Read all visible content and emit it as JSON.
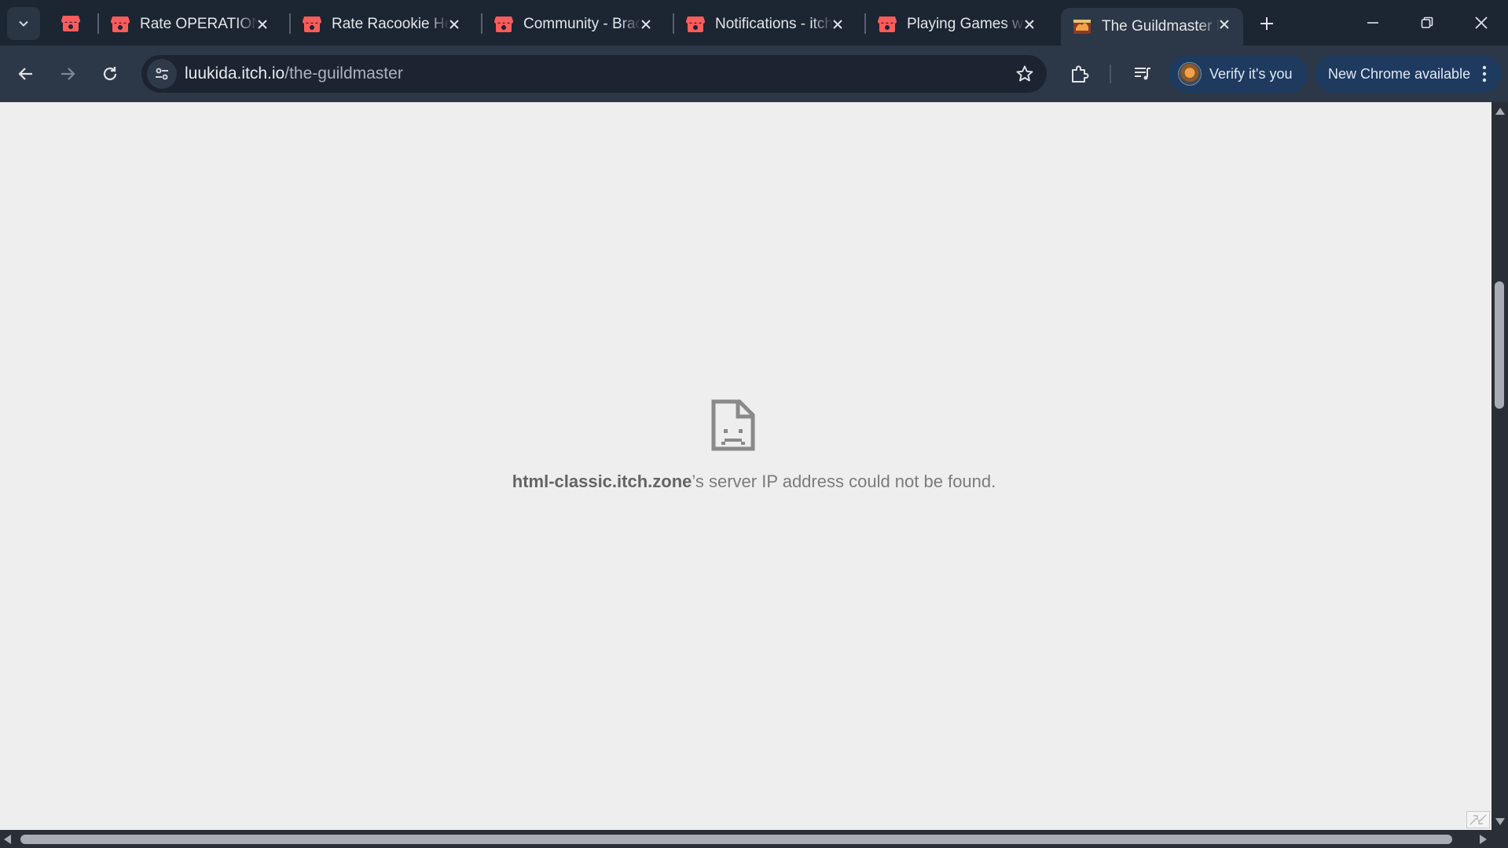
{
  "window": {
    "tabs": [
      {
        "title": "Rate OPERATION",
        "active": false
      },
      {
        "title": "Rate Racookie Heist",
        "active": false
      },
      {
        "title": "Community - Brackeys",
        "active": false
      },
      {
        "title": "Notifications - itch.io",
        "active": false
      },
      {
        "title": "Playing Games with",
        "active": false
      },
      {
        "title": "The Guildmaster by",
        "active": true
      }
    ],
    "icons": {
      "tab_search": "chevron-down-icon",
      "pinned": "itchio-icon",
      "new_tab": "plus-icon",
      "minimize": "minimize-icon",
      "restore": "restore-icon",
      "close": "close-icon"
    }
  },
  "toolbar": {
    "url_host": "luukida.itch.io",
    "url_path": "/the-guildmaster",
    "verify_label": "Verify it's you",
    "update_label": "New Chrome available"
  },
  "page": {
    "error_host": "html-classic.itch.zone",
    "error_message": "’s server IP address could not be found."
  },
  "colors": {
    "tab_strip": "#1c2532",
    "toolbar": "#2c3847",
    "page_background": "#eeeeee",
    "itchio_red": "#fa5c5c",
    "pill_blue": "#1e3a5f"
  }
}
